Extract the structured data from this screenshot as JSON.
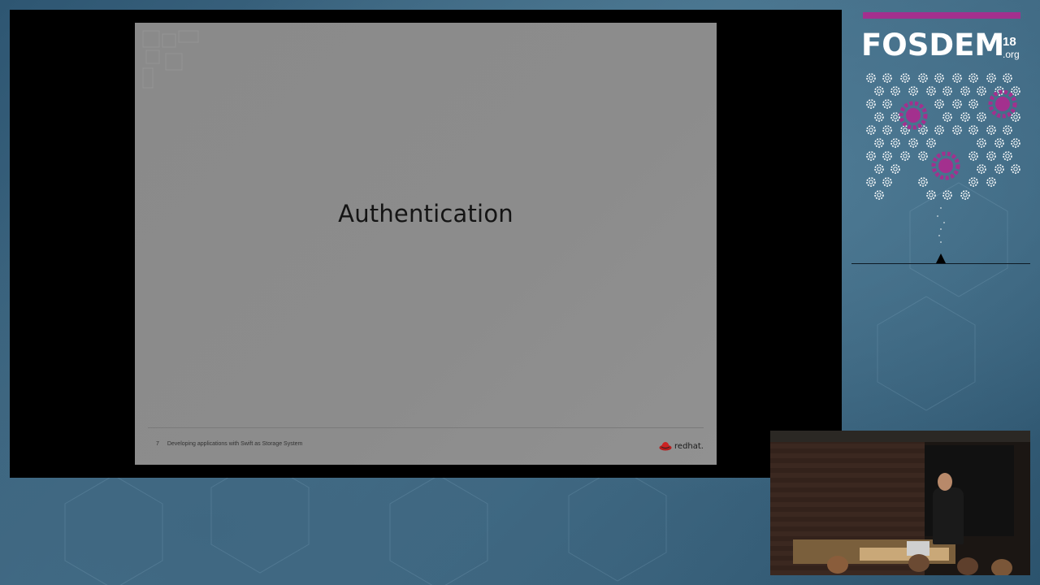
{
  "slide": {
    "title": "Authentication",
    "page_number": "7",
    "footer_text": "Developing applications with Swift as Storage System",
    "logo_text": "redhat."
  },
  "branding": {
    "name": "FOSDEM",
    "year": "18",
    "domain": ".org",
    "accent_color": "#a3308e"
  },
  "camera": {
    "description_icon": "speaker-camera-feed"
  }
}
